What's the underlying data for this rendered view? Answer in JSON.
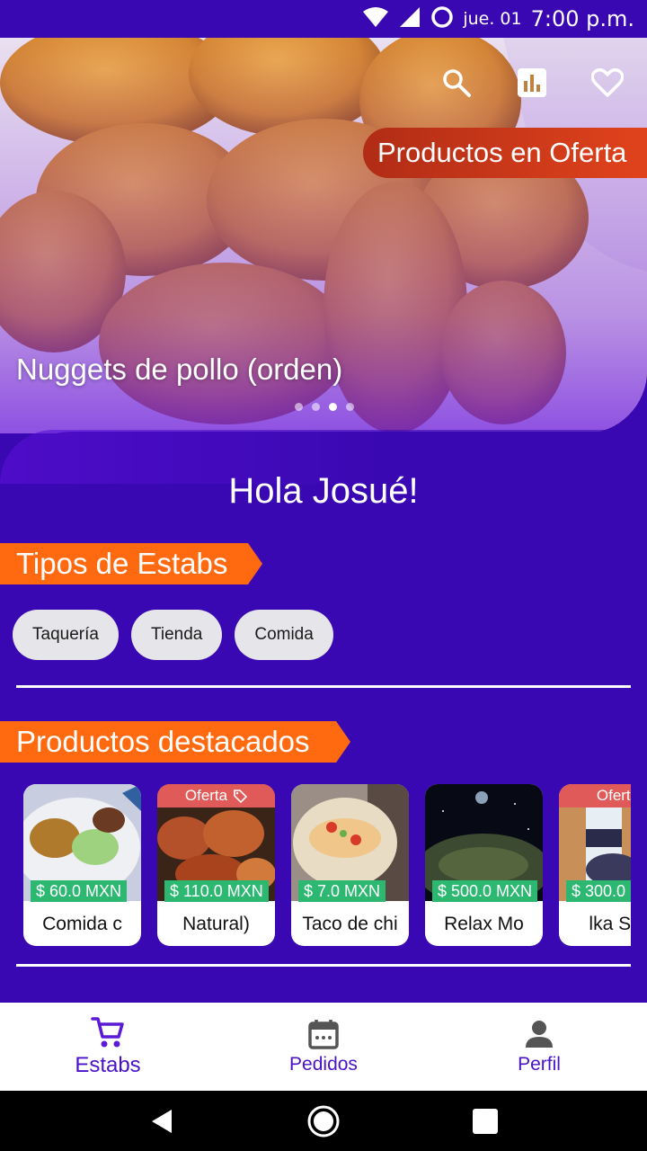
{
  "status_bar": {
    "date": "jue. 01",
    "time": "7:00 p.m."
  },
  "hero": {
    "offer_label": "Productos en Oferta",
    "title": "Nuggets de pollo (orden)",
    "dots": 4,
    "active_dot": 2,
    "icons": [
      "search-icon",
      "bar-chart-icon",
      "heart-icon"
    ]
  },
  "greeting": "Hola Josué!",
  "types_section": {
    "title": "Tipos de Estabs",
    "chips": [
      "Taquería",
      "Tienda",
      "Comida"
    ]
  },
  "featured_section": {
    "title": "Productos destacados",
    "products": [
      {
        "name": "Comida c",
        "price": "$ 60.0 MXN",
        "offer": ""
      },
      {
        "name": "Natural)",
        "price": "$ 110.0 MXN",
        "offer": "Oferta"
      },
      {
        "name": "Taco de chi",
        "price": "$ 7.0 MXN",
        "offer": ""
      },
      {
        "name": "Relax Mo",
        "price": "$ 500.0 MXN",
        "offer": ""
      },
      {
        "name": "lka Sm",
        "price": "$ 300.0",
        "offer": "Oferta"
      }
    ]
  },
  "bottom_nav": {
    "items": [
      {
        "label": "Estabs",
        "icon": "cart-icon",
        "active": true
      },
      {
        "label": "Pedidos",
        "icon": "calendar-icon",
        "active": false
      },
      {
        "label": "Perfil",
        "icon": "person-icon",
        "active": false
      }
    ]
  },
  "colors": {
    "primary": "#3a08b2",
    "accent_orange": "#ff6a10",
    "offer_red": "#d83a1a",
    "price_green": "#2db872",
    "nav_text": "#4a12c8"
  }
}
